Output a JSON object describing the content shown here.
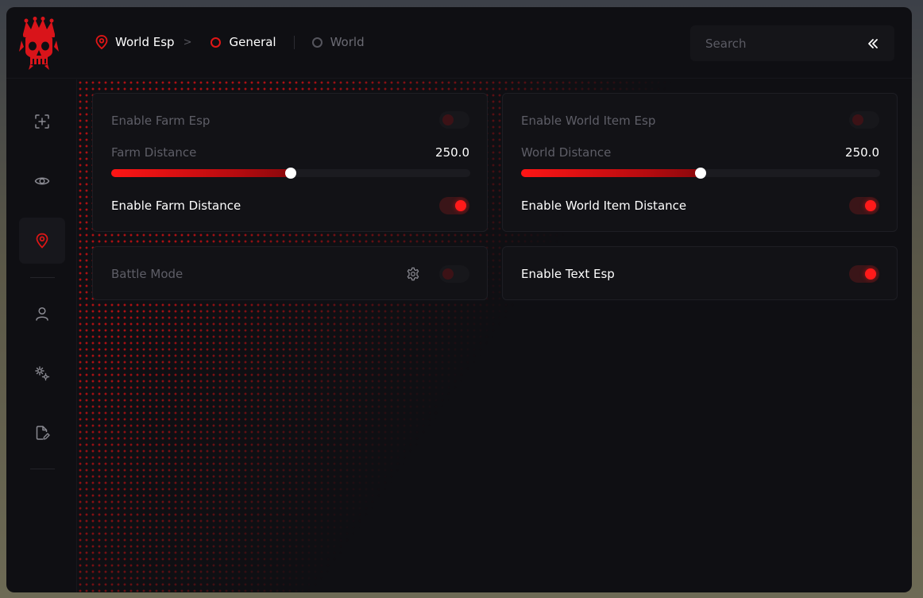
{
  "breadcrumb": {
    "items": [
      {
        "label": "World Esp",
        "icon": "location-pin-icon"
      },
      {
        "label": "General",
        "icon": "ring-icon",
        "active": true
      },
      {
        "label": "World",
        "icon": "ring-icon",
        "active": false
      }
    ],
    "separator": ">"
  },
  "search": {
    "placeholder": "Search",
    "collapse_icon": "double-chevron-left-icon"
  },
  "sidebar": {
    "items": [
      {
        "icon": "crosshair-plus-icon",
        "active": false
      },
      {
        "icon": "eye-icon",
        "active": false
      },
      {
        "icon": "location-pin-icon",
        "active": true
      },
      {
        "icon": "user-icon",
        "active": false
      },
      {
        "icon": "gears-icon",
        "active": false
      },
      {
        "icon": "file-edit-icon",
        "active": false
      }
    ]
  },
  "panels": {
    "farm": {
      "enable_label": "Enable Farm Esp",
      "enable_on": false,
      "distance_label": "Farm Distance",
      "distance_value": "250.0",
      "distance_fraction": 0.5,
      "distance_toggle_label": "Enable Farm Distance",
      "distance_toggle_on": true
    },
    "world": {
      "enable_label": "Enable World Item Esp",
      "enable_on": false,
      "distance_label": "World Distance",
      "distance_value": "250.0",
      "distance_fraction": 0.5,
      "distance_toggle_label": "Enable World Item Distance",
      "distance_toggle_on": true
    },
    "battle": {
      "label": "Battle Mode",
      "on": false,
      "settings_icon": "gear-icon"
    },
    "text": {
      "label": "Enable Text Esp",
      "on": true
    }
  },
  "colors": {
    "accent": "#ff1a1a",
    "background": "#0f0f13",
    "panel": "#121216"
  }
}
